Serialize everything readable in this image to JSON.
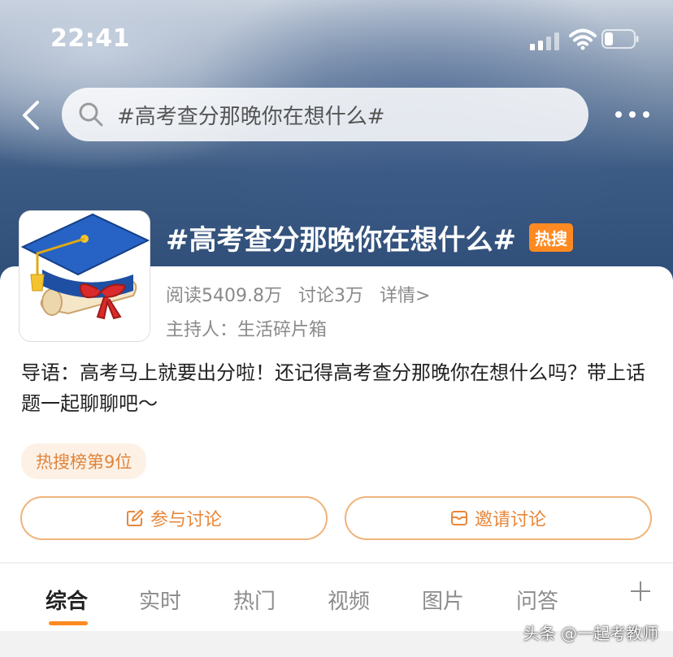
{
  "status_bar": {
    "time": "22:41"
  },
  "search": {
    "query": "#高考查分那晚你在想什么#"
  },
  "topic": {
    "title": "#高考查分那晚你在想什么#",
    "badge": "热搜",
    "reads": "阅读5409.8万",
    "discussions": "讨论3万",
    "details": "详情>",
    "host_label": "主持人：",
    "host_name": "生活碎片箱",
    "intro": "导语：高考马上就要出分啦！还记得高考查分那晚你在想什么吗？带上话题一起聊聊吧～",
    "rank": "热搜榜第9位"
  },
  "buttons": {
    "join": "参与讨论",
    "invite": "邀请讨论"
  },
  "tabs": [
    {
      "label": "综合"
    },
    {
      "label": "实时"
    },
    {
      "label": "热门"
    },
    {
      "label": "视频"
    },
    {
      "label": "图片"
    },
    {
      "label": "问答"
    }
  ],
  "watermark": "头条 @一起考教师",
  "colors": {
    "accent": "#ff8a22",
    "button_text": "#e8873a",
    "button_border": "#f0b47c"
  }
}
